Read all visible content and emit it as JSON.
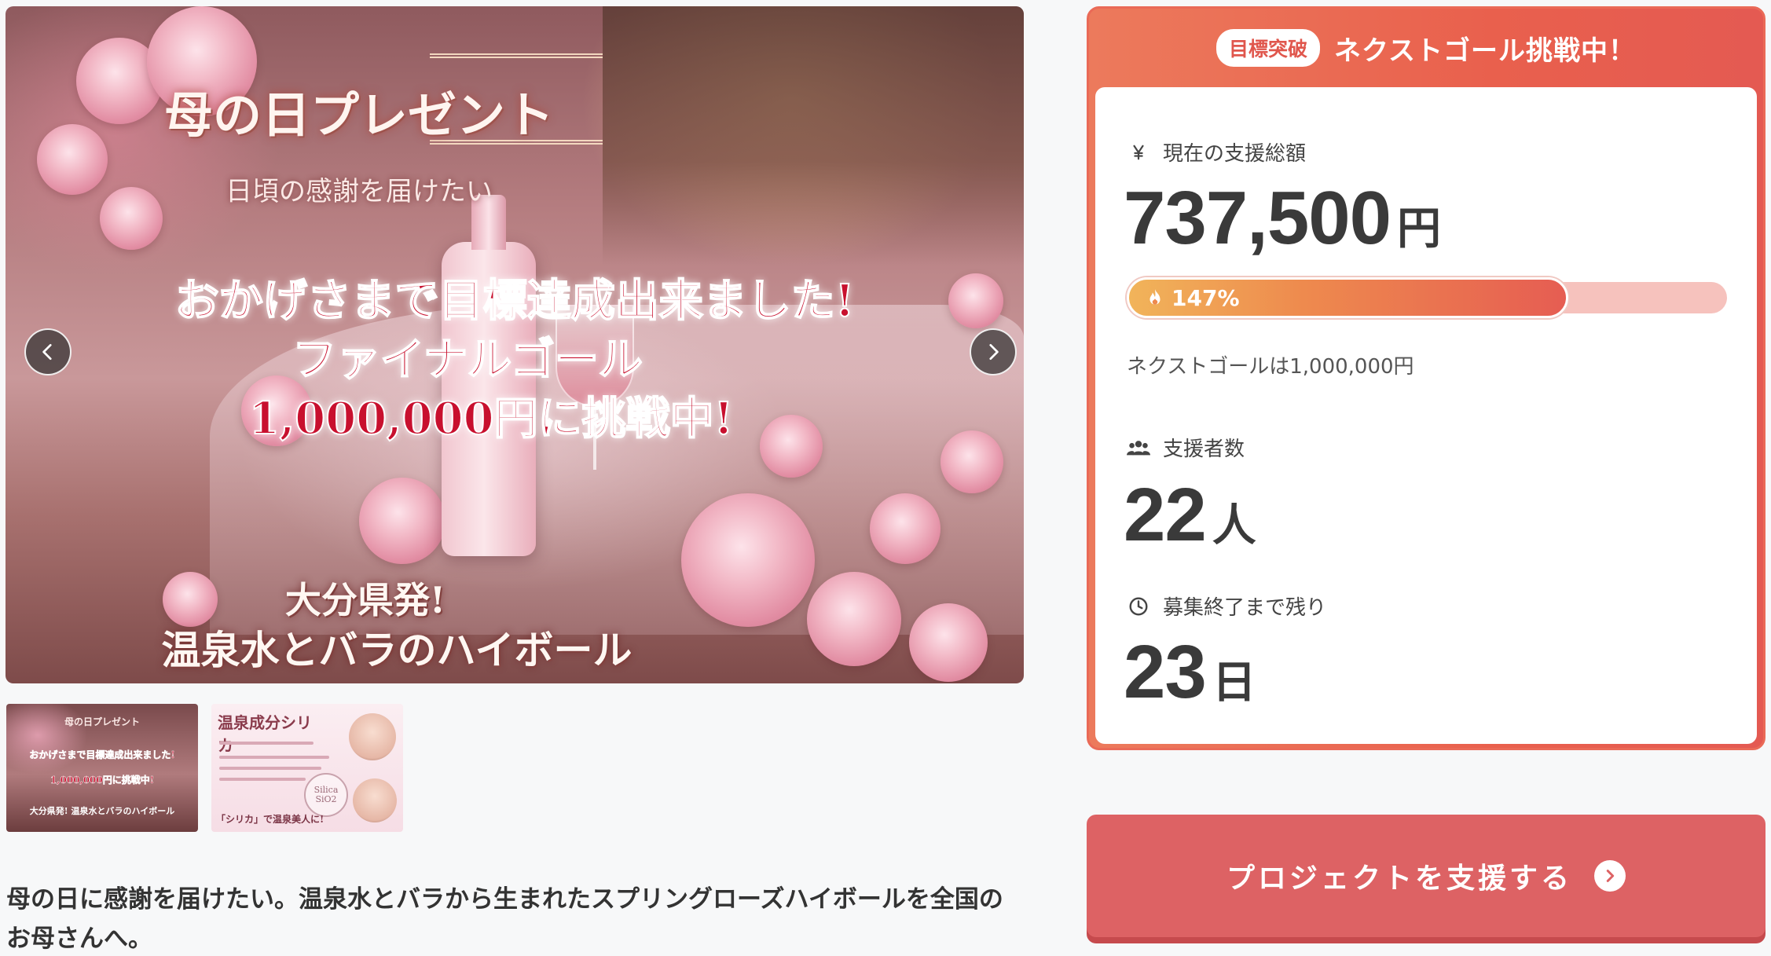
{
  "hero": {
    "title": "母の日プレゼント",
    "subtitle": "日頃の感謝を届けたい",
    "line1": "おかげさまで目標達成出来ました!",
    "line2": "ファイナルゴール",
    "line3": "1,000,000円に挑戦中!",
    "line4": "大分県発!",
    "line5": "温泉水とバラのハイボール"
  },
  "thumbnails": [
    {
      "lines": [
        "母の日プレゼント",
        "おかげさまで目標達成出来ました!",
        "1,000,000円に挑戦中!",
        "大分県発! 温泉水とバラのハイボール"
      ]
    },
    {
      "heading": "温泉成分シリカ",
      "seal": "Silica SiO2",
      "caption": "「シリカ」で温泉美人に!"
    }
  ],
  "description": "母の日に感謝を届けたい。温泉水とバラから生まれたスプリングローズハイボールを全国のお母さんへ。",
  "card": {
    "badge": "目標突破",
    "title": "ネクストゴール挑戦中！",
    "total_label": "現在の支援総額",
    "total_value": "737,500",
    "total_unit": "円",
    "progress_percent": 147,
    "progress_label": "147%",
    "next_goal": "ネクストゴールは1,000,000円",
    "supporters_label": "支援者数",
    "supporters_value": "22",
    "supporters_unit": "人",
    "remaining_label": "募集終了まで残り",
    "remaining_value": "23",
    "remaining_unit": "日"
  },
  "cta": {
    "label": "プロジェクトを支援する"
  },
  "colors": {
    "accent": "#e9604d",
    "cta": "#dd6264",
    "progress_track": "#f6c2bd"
  },
  "icons": [
    "chevron-left-icon",
    "chevron-right-icon",
    "yen-icon",
    "fire-icon",
    "people-icon",
    "clock-icon",
    "arrow-circle-right-icon"
  ]
}
